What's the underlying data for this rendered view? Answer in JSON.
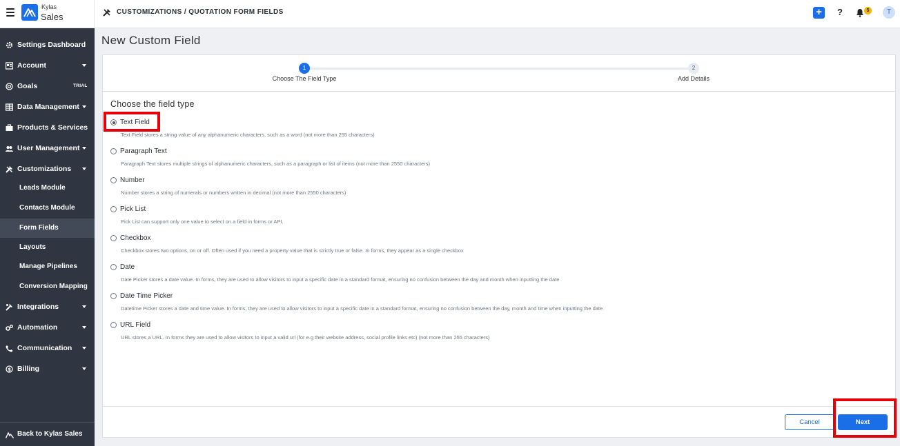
{
  "header": {
    "brand_small": "Kylas",
    "brand_main": "Sales",
    "breadcrumb": "CUSTOMIZATIONS / QUOTATION FORM FIELDS",
    "help": "?",
    "notification_count": "5",
    "avatar_initial": "T",
    "plus": "+"
  },
  "sidebar": {
    "items": [
      {
        "label": "Settings Dashboard",
        "icon": "gear-icon"
      },
      {
        "label": "Account",
        "icon": "account-icon"
      },
      {
        "label": "Goals",
        "icon": "target-icon",
        "badge": "TRIAL"
      },
      {
        "label": "Data Management",
        "icon": "table-icon"
      },
      {
        "label": "Products & Services",
        "icon": "briefcase-icon"
      },
      {
        "label": "User Management",
        "icon": "users-icon"
      },
      {
        "label": "Customizations",
        "icon": "tools-icon"
      }
    ],
    "sub_items": [
      {
        "label": "Leads Module"
      },
      {
        "label": "Contacts Module"
      },
      {
        "label": "Form Fields"
      },
      {
        "label": "Layouts"
      },
      {
        "label": "Manage Pipelines"
      },
      {
        "label": "Conversion Mapping"
      }
    ],
    "items_after": [
      {
        "label": "Integrations",
        "icon": "puzzle-icon"
      },
      {
        "label": "Automation",
        "icon": "cogs-icon"
      },
      {
        "label": "Communication",
        "icon": "phone-icon"
      },
      {
        "label": "Billing",
        "icon": "dollar-icon"
      }
    ],
    "footer": "Back to Kylas Sales"
  },
  "page": {
    "title": "New Custom Field",
    "steps": [
      {
        "number": "1",
        "label": "Choose The Field Type"
      },
      {
        "number": "2",
        "label": "Add Details"
      }
    ],
    "section_title": "Choose the field type",
    "options": [
      {
        "name": "Text Field",
        "desc": "Text Field stores a string value of any alphanumeric characters, such as a word (not more than 255 characters)",
        "checked": true
      },
      {
        "name": "Paragraph Text",
        "desc": "Paragraph Text stores multiple strings of alphanumeric characters, such as a paragraph or list of items (not more than 2550 characters)"
      },
      {
        "name": "Number",
        "desc": "Number stores a string of numerals or numbers written in decimal (not more than 2550 characters)"
      },
      {
        "name": "Pick List",
        "desc": "Pick List can support only one value to select on a field in forms or API."
      },
      {
        "name": "Checkbox",
        "desc": "Checkbox stores two options, on or off. Often used if you need a property value that is strictly true or false. In forms, they appear as a single checkbox"
      },
      {
        "name": "Date",
        "desc": "Date Picker stores a date value. In forms, they are used to allow visitors to input a specific date in a standard format, ensuring no confusion between the day and month when inputting the date"
      },
      {
        "name": "Date Time Picker",
        "desc": "Datetime Picker stores a date and time value. In forms, they are used to allow visitors to input a specific date in a standard format, ensuring no confusion between the day, month and time when inputting the date."
      },
      {
        "name": "URL Field",
        "desc": "URL stores a URL. In forms they are used to allow visitors to input a valid url (for e.g their website address, social profile links etc) (not more than 255 characters)"
      }
    ],
    "cancel_label": "Cancel",
    "next_label": "Next"
  },
  "colors": {
    "accent": "#1a6ee8",
    "sidebar_bg": "#2f3541",
    "highlight": "#e6000a"
  }
}
